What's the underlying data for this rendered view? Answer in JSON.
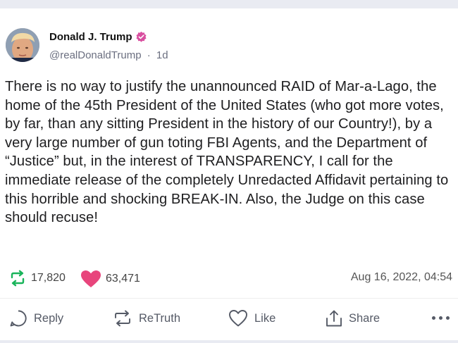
{
  "post": {
    "author_name": "Donald J. Trump",
    "handle": "@realDonaldTrump",
    "age_sep": "·",
    "age": "1d",
    "text": "There is no way to justify the unannounced RAID of Mar-a-Lago, the home of the 45th President of the United States (who got more votes, by far, than any sitting President in the history of our Country!), by a very large number of gun toting FBI Agents, and the Department of “Justice” but, in the interest of TRANSPARENCY, I call for the immediate release of the completely Unredacted Affidavit pertaining to this horrible and shocking BREAK-IN. Also, the Judge on this case should recuse!",
    "retruths": "17,820",
    "likes": "63,471",
    "timestamp": "Aug 16, 2022, 04:54"
  },
  "actions": {
    "reply": "Reply",
    "retruth": "ReTruth",
    "like": "Like",
    "share": "Share"
  },
  "colors": {
    "verified": "#d94fa0",
    "retruth": "#19b45a",
    "heart": "#e8457c"
  },
  "icons": {
    "verified": "verified-badge-icon",
    "retruth_stat": "retruth-icon",
    "like_stat": "heart-icon",
    "reply": "reply-icon",
    "retruth": "retruth-icon",
    "like": "heart-outline-icon",
    "share": "share-icon",
    "more": "more-icon"
  }
}
